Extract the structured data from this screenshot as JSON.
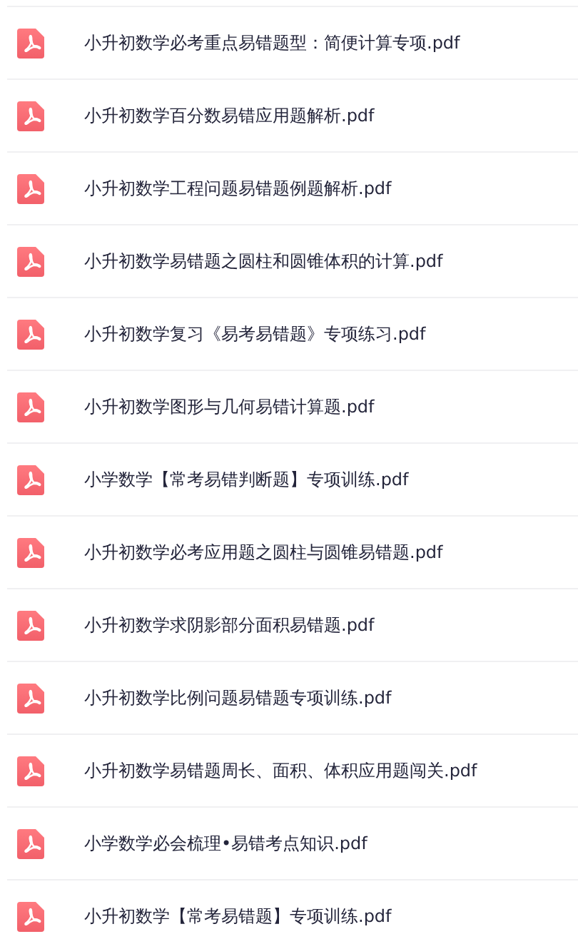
{
  "files": [
    {
      "name": "小升初数学必考重点易错题型：简便计算专项.pdf"
    },
    {
      "name": "小升初数学百分数易错应用题解析.pdf"
    },
    {
      "name": "小升初数学工程问题易错题例题解析.pdf"
    },
    {
      "name": "小升初数学易错题之圆柱和圆锥体积的计算.pdf"
    },
    {
      "name": "小升初数学复习《易考易错题》专项练习.pdf"
    },
    {
      "name": "小升初数学图形与几何易错计算题.pdf"
    },
    {
      "name": "小学数学【常考易错判断题】专项训练.pdf"
    },
    {
      "name": "小升初数学必考应用题之圆柱与圆锥易错题.pdf"
    },
    {
      "name": "小升初数学求阴影部分面积易错题.pdf"
    },
    {
      "name": "小升初数学比例问题易错题专项训练.pdf"
    },
    {
      "name": "小升初数学易错题周长、面积、体积应用题闯关.pdf"
    },
    {
      "name": "小学数学必会梳理•易错考点知识.pdf"
    },
    {
      "name": "小升初数学【常考易错题】专项训练.pdf"
    }
  ]
}
